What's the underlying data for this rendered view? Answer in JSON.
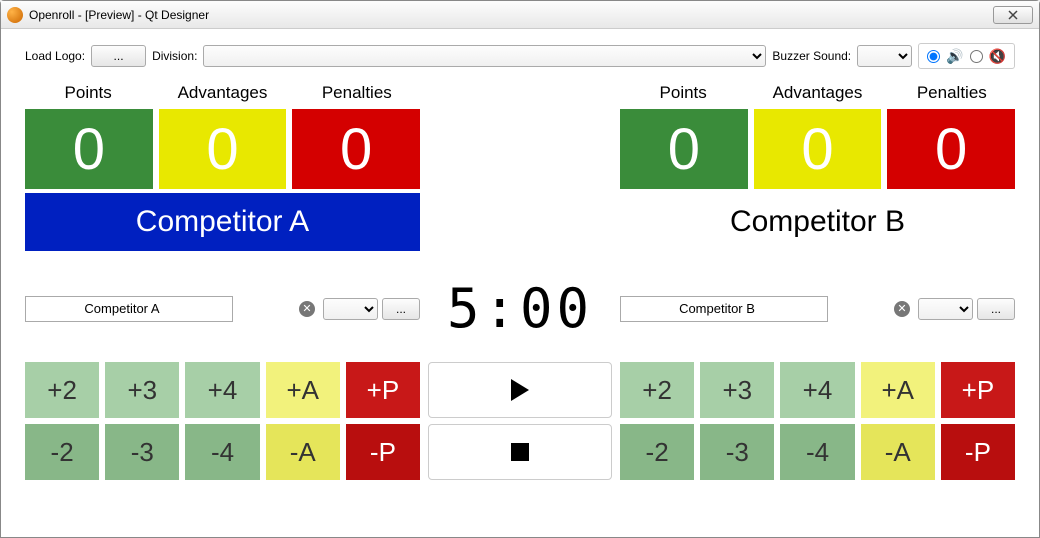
{
  "window": {
    "title": "Openroll - [Preview] - Qt Designer"
  },
  "toolbar": {
    "load_logo_label": "Load Logo:",
    "load_logo_btn": "...",
    "division_label": "Division:",
    "buzzer_label": "Buzzer Sound:"
  },
  "headers": {
    "points": "Points",
    "advantages": "Advantages",
    "penalties": "Penalties"
  },
  "a": {
    "points": "0",
    "advantages": "0",
    "penalties": "0",
    "name": "Competitor A",
    "input_value": "Competitor A",
    "more_btn": "...",
    "buttons_plus": [
      "+2",
      "+3",
      "+4",
      "+A",
      "+P"
    ],
    "buttons_minus": [
      "-2",
      "-3",
      "-4",
      "-A",
      "-P"
    ]
  },
  "b": {
    "points": "0",
    "advantages": "0",
    "penalties": "0",
    "name": "Competitor B",
    "input_value": "Competitor B",
    "more_btn": "...",
    "buttons_plus": [
      "+2",
      "+3",
      "+4",
      "+A",
      "+P"
    ],
    "buttons_minus": [
      "-2",
      "-3",
      "-4",
      "-A",
      "-P"
    ]
  },
  "timer": "5:00"
}
